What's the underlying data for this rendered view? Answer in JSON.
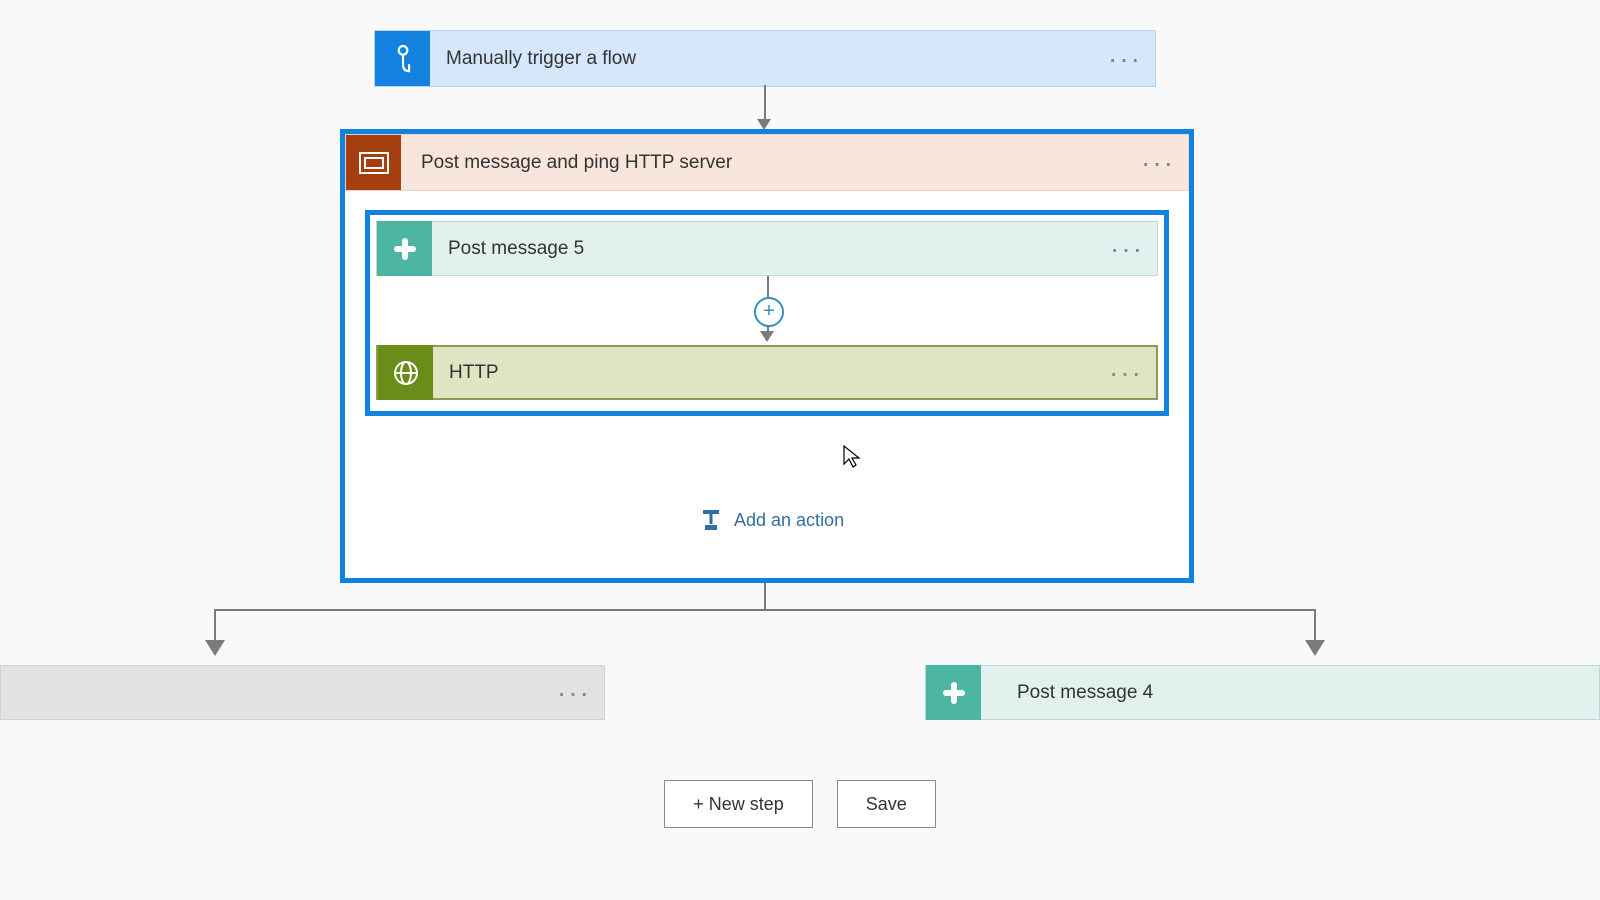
{
  "trigger": {
    "label": "Manually trigger a flow"
  },
  "scope": {
    "title": "Post message and ping HTTP server"
  },
  "scope_children": {
    "post5": "Post message 5",
    "http": "HTTP"
  },
  "add_action_label": "Add an action",
  "branches": {
    "right": "Post message 4"
  },
  "footer": {
    "new_step": "+ New step",
    "save": "Save"
  },
  "ellipsis": "···"
}
